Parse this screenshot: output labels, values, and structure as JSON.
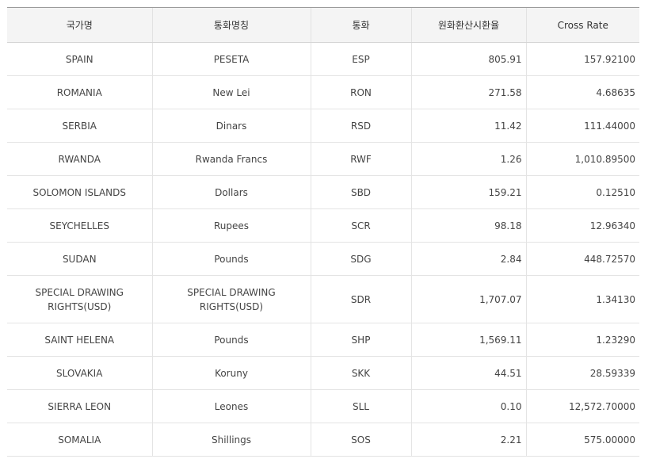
{
  "table": {
    "headers": {
      "country": "국가명",
      "currency_name": "통화명칭",
      "currency": "통화",
      "krw_rate": "원화환산시환율",
      "cross_rate": "Cross Rate"
    },
    "rows": [
      {
        "country": "SPAIN",
        "currency_name": "PESETA",
        "currency": "ESP",
        "krw_rate": "805.91",
        "cross_rate": "157.92100"
      },
      {
        "country": "ROMANIA",
        "currency_name": "New Lei",
        "currency": "RON",
        "krw_rate": "271.58",
        "cross_rate": "4.68635"
      },
      {
        "country": "SERBIA",
        "currency_name": "Dinars",
        "currency": "RSD",
        "krw_rate": "11.42",
        "cross_rate": "111.44000"
      },
      {
        "country": "RWANDA",
        "currency_name": "Rwanda Francs",
        "currency": "RWF",
        "krw_rate": "1.26",
        "cross_rate": "1,010.89500"
      },
      {
        "country": "SOLOMON ISLANDS",
        "currency_name": "Dollars",
        "currency": "SBD",
        "krw_rate": "159.21",
        "cross_rate": "0.12510"
      },
      {
        "country": "SEYCHELLES",
        "currency_name": "Rupees",
        "currency": "SCR",
        "krw_rate": "98.18",
        "cross_rate": "12.96340"
      },
      {
        "country": "SUDAN",
        "currency_name": "Pounds",
        "currency": "SDG",
        "krw_rate": "2.84",
        "cross_rate": "448.72570"
      },
      {
        "country": "SPECIAL DRAWING RIGHTS(USD)",
        "currency_name": "SPECIAL DRAWING RIGHTS(USD)",
        "currency": "SDR",
        "krw_rate": "1,707.07",
        "cross_rate": "1.34130"
      },
      {
        "country": "SAINT HELENA",
        "currency_name": "Pounds",
        "currency": "SHP",
        "krw_rate": "1,569.11",
        "cross_rate": "1.23290"
      },
      {
        "country": "SLOVAKIA",
        "currency_name": "Koruny",
        "currency": "SKK",
        "krw_rate": "44.51",
        "cross_rate": "28.59339"
      },
      {
        "country": "SIERRA LEON",
        "currency_name": "Leones",
        "currency": "SLL",
        "krw_rate": "0.10",
        "cross_rate": "12,572.70000"
      },
      {
        "country": "SOMALIA",
        "currency_name": "Shillings",
        "currency": "SOS",
        "krw_rate": "2.21",
        "cross_rate": "575.00000"
      }
    ]
  }
}
